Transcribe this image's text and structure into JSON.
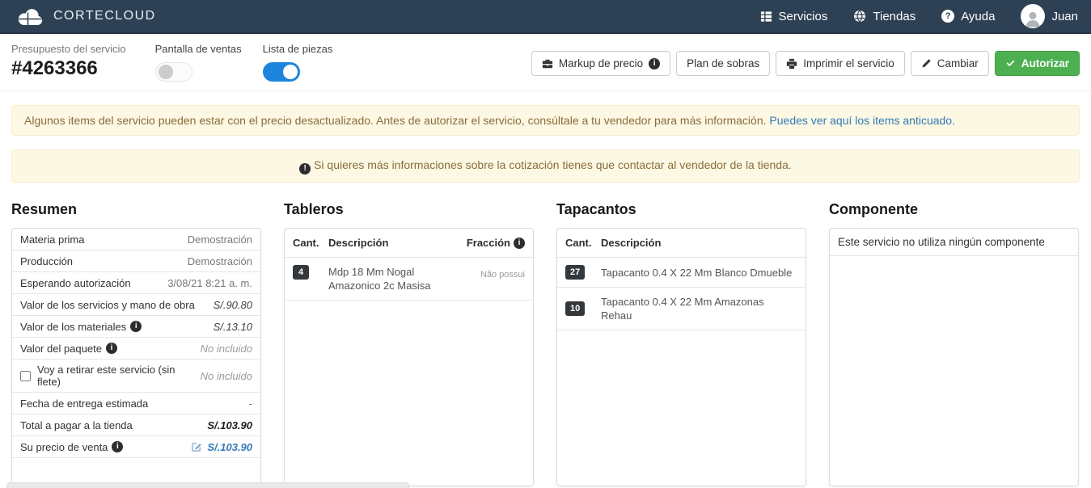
{
  "navbar": {
    "brand": "CORTECLOUD",
    "servicios": "Servicios",
    "tiendas": "Tiendas",
    "ayuda": "Ayuda",
    "user": "Juan"
  },
  "header": {
    "budget_label": "Presupuesto del servicio",
    "budget_number": "#4263366",
    "toggle_sales": {
      "label": "Pantalla de ventas",
      "state": "off"
    },
    "toggle_pieces": {
      "label": "Lista de piezas",
      "state": "on"
    },
    "buttons": {
      "markup": "Markup de precio",
      "plan": "Plan de sobras",
      "print": "Imprimir el servicio",
      "change": "Cambiar",
      "authorize": "Autorizar"
    }
  },
  "alerts": {
    "outdated": {
      "text": "Algunos items del servicio pueden estar con el precio desactualizado. Antes de autorizar el servicio, consúltale a tu vendedor para más información.",
      "link": "Puedes ver aquí los items anticuado."
    },
    "contact": {
      "text": "Si quieres más informaciones sobre la cotización tienes que contactar al vendedor de la tienda."
    }
  },
  "resumen": {
    "title": "Resumen",
    "rows": [
      {
        "label": "Materia prima",
        "value": "Demostración"
      },
      {
        "label": "Producción",
        "value": "Demostración"
      },
      {
        "label": "Esperando autorización",
        "value": "3/08/21 8:21 a. m."
      },
      {
        "label": "Valor de los servicios y mano de obra",
        "value": "S/.90.80"
      },
      {
        "label": "Valor de los materiales",
        "value": "S/.13.10"
      },
      {
        "label": "Valor del paquete",
        "value": "No incluido"
      },
      {
        "label": "Voy a retirar este servicio (sin flete)",
        "value": "No incluido"
      },
      {
        "label": "Fecha de entrega estimada",
        "value": "-"
      },
      {
        "label": "Total a pagar a la tienda",
        "value": "S/.103.90"
      },
      {
        "label": "Su precio de venta",
        "value": "S/.103.90"
      }
    ]
  },
  "tableros": {
    "title": "Tableros",
    "headers": {
      "qty": "Cant.",
      "desc": "Descripción",
      "fraction": "Fracción"
    },
    "rows": [
      {
        "qty": "4",
        "desc": "Mdp 18 Mm Nogal Amazonico 2c Masisa",
        "fraction": "Não possui"
      }
    ]
  },
  "tapacantos": {
    "title": "Tapacantos",
    "headers": {
      "qty": "Cant.",
      "desc": "Descripción"
    },
    "rows": [
      {
        "qty": "27",
        "desc": "Tapacanto 0.4 X 22 Mm Blanco Dmueble"
      },
      {
        "qty": "10",
        "desc": "Tapacanto 0.4 X 22 Mm Amazonas Rehau"
      }
    ]
  },
  "componente": {
    "title": "Componente",
    "empty_message": "Este servicio no utiliza ningún componente"
  },
  "icons": {
    "info_glyph": "i",
    "alert_glyph": "!",
    "question_glyph": "?"
  },
  "colors": {
    "navbar_bg": "#2e4154",
    "toggle_on_blue": "#1d85dd",
    "authorize_green": "#4cb050",
    "link_blue": "#337ab7",
    "alert_bg": "#fcf8e3",
    "alert_text": "#8a6d3b",
    "badge_bg": "#33383d"
  }
}
